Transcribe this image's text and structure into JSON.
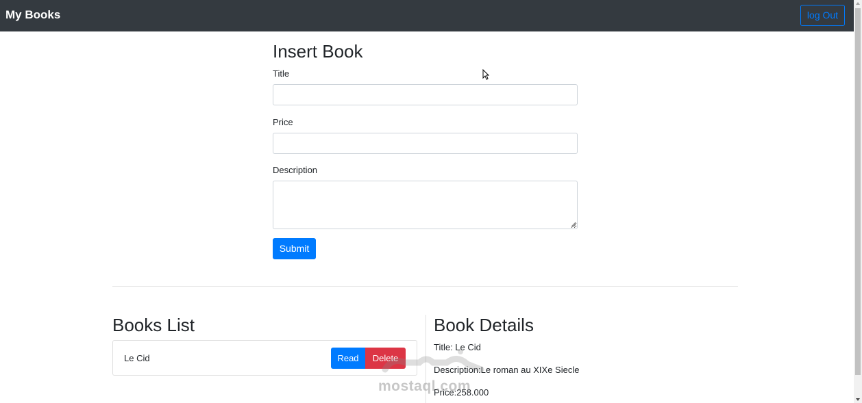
{
  "navbar": {
    "brand": "My Books",
    "logout_label": "log Out",
    "background": "#343a40",
    "logout_color": "#007bff"
  },
  "insert_form": {
    "heading": "Insert Book",
    "title_label": "Title",
    "title_value": "",
    "price_label": "Price",
    "price_value": "",
    "description_label": "Description",
    "description_value": "",
    "submit_label": "Submit"
  },
  "books_list": {
    "heading": "Books List",
    "items": [
      {
        "title": "Le Cid",
        "read_label": "Read",
        "delete_label": "Delete"
      }
    ]
  },
  "book_details": {
    "heading": "Book Details",
    "title_line": "Title: Le Cid",
    "description_line": "Description:Le roman au XIXe Siecle",
    "price_line": "Price:258.000"
  },
  "watermark": {
    "text": "mostaql.com"
  },
  "colors": {
    "primary": "#007bff",
    "danger": "#dc3545"
  }
}
